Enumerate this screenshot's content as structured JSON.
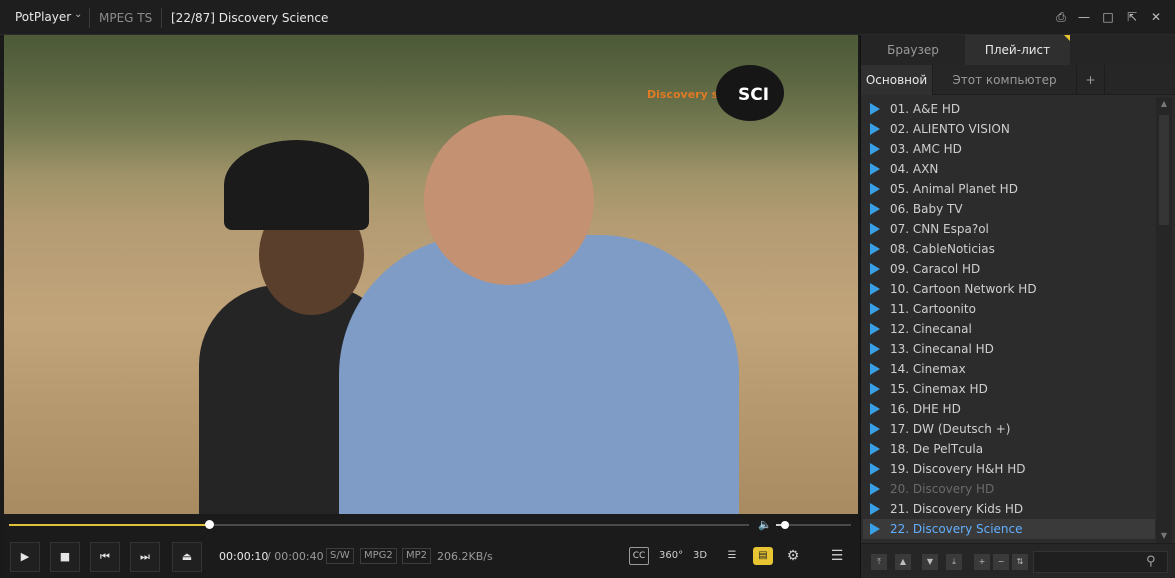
{
  "titlebar": {
    "brand": "PotPlayer",
    "format": "MPEG TS",
    "title": "[22/87] Discovery Science",
    "icons": [
      "pin-icon",
      "minimize-icon",
      "maximize-icon",
      "fullscreen-icon",
      "close-icon"
    ]
  },
  "video": {
    "logo_small": "Discovery science",
    "logo_badge": "SCI"
  },
  "playback": {
    "progress": 0.27,
    "volume": 0.12,
    "current_time": "00:00:10",
    "total_time": "/ 00:00:40",
    "decoder": "S/W",
    "video_codec": "MPG2",
    "audio_codec": "MP2",
    "bitrate": "206.2KB/s",
    "cc_label": "CC",
    "vr_label": "360°",
    "3d_label": "3D"
  },
  "panel": {
    "tabs": [
      "Браузер",
      "Плей-лист"
    ],
    "subtabs": [
      "Основной",
      "Этот компьютер",
      "+"
    ],
    "playlist": [
      "01. A&E HD",
      "02. ALIENTO VISION",
      "03. AMC HD",
      "04. AXN",
      "05. Animal Planet HD",
      "06. Baby TV",
      "07. CNN Espa?ol",
      "08. CableNoticias",
      "09. Caracol HD",
      "10. Cartoon Network HD",
      "11. Cartoonito",
      "12. Cinecanal",
      "13. Cinecanal HD",
      "14. Cinemax",
      "15. Cinemax HD",
      "16. DHE HD",
      "17. DW (Deutsch +)",
      "18. De PelТcula",
      "19. Discovery H&H HD",
      "20. Discovery HD",
      "21. Discovery Kids HD",
      "22. Discovery Science"
    ],
    "current_index": 21,
    "dimmed_index": 19
  },
  "colors": {
    "accent_yellow": "#e7c532",
    "play_blue": "#3aa0e6",
    "current_text": "#62b0ff"
  }
}
